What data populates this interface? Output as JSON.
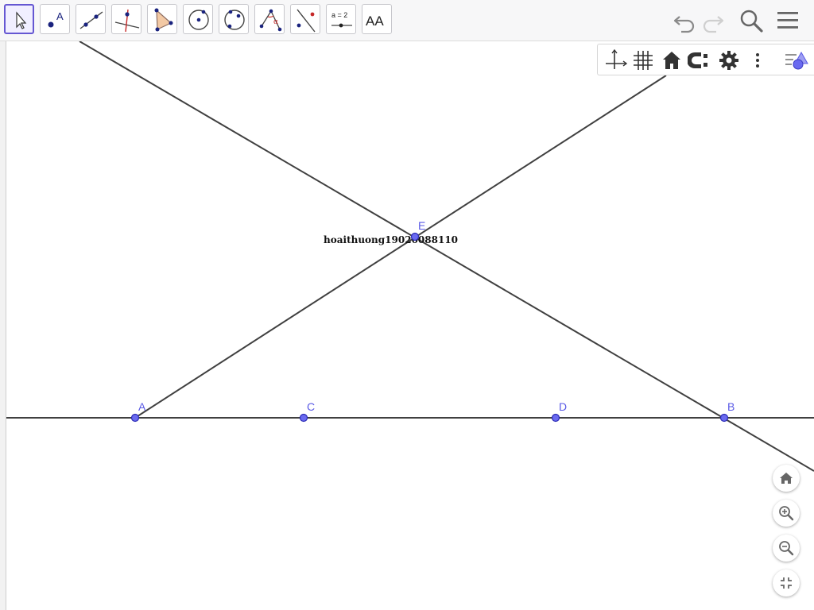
{
  "toolbar": {
    "tools": [
      {
        "icon": "move-arrow-icon"
      },
      {
        "icon": "point-icon",
        "glyph": "A"
      },
      {
        "icon": "line-icon"
      },
      {
        "icon": "perpendicular-line-icon"
      },
      {
        "icon": "polygon-icon"
      },
      {
        "icon": "circle-with-center-icon"
      },
      {
        "icon": "circle-through-points-icon"
      },
      {
        "icon": "angle-icon",
        "glyph": "α"
      },
      {
        "icon": "reflect-icon"
      },
      {
        "icon": "slider-icon",
        "glyph": "a = 2"
      },
      {
        "icon": "text-icon",
        "glyph": "AA"
      }
    ],
    "right": [
      "undo-icon",
      "redo-icon",
      "search-icon",
      "menu-icon"
    ]
  },
  "style_bar": {
    "buttons": [
      "axes-toggle-icon",
      "grid-toggle-icon",
      "standard-view-icon",
      "point-capturing-icon",
      "graphics-settings-icon",
      "more-options-icon",
      "style-bar-collapse-icon"
    ]
  },
  "graphics": {
    "points": [
      {
        "label": "A"
      },
      {
        "label": "C"
      },
      {
        "label": "D"
      },
      {
        "label": "B"
      },
      {
        "label": "E"
      }
    ],
    "text_object": "hoaithuong19020088110"
  },
  "zoom_panel": [
    "home-view-icon",
    "zoom-in-icon",
    "zoom-out-icon",
    "exit-fullscreen-icon"
  ],
  "colors": {
    "point_fill": "#6a6af0",
    "point_label": "#5a5ae6",
    "line": "#404040",
    "active_tool": "#6557d2",
    "icon": "#666666"
  }
}
